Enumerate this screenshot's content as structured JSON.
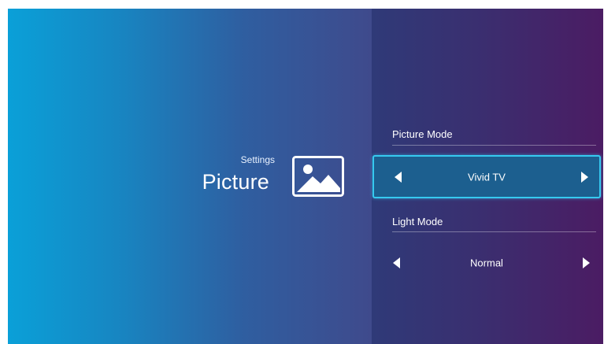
{
  "header": {
    "breadcrumb": "Settings",
    "title": "Picture",
    "icon": "picture-icon"
  },
  "settings": [
    {
      "label": "Picture Mode",
      "value": "Vivid TV",
      "focused": true
    },
    {
      "label": "Light Mode",
      "value": "Normal",
      "focused": false
    }
  ],
  "colors": {
    "focus_border": "#36c9f0",
    "focus_fill": "#1c5f8f",
    "left_gradient_start": "#0aa0d8",
    "right_gradient_end": "#4b1c63"
  }
}
